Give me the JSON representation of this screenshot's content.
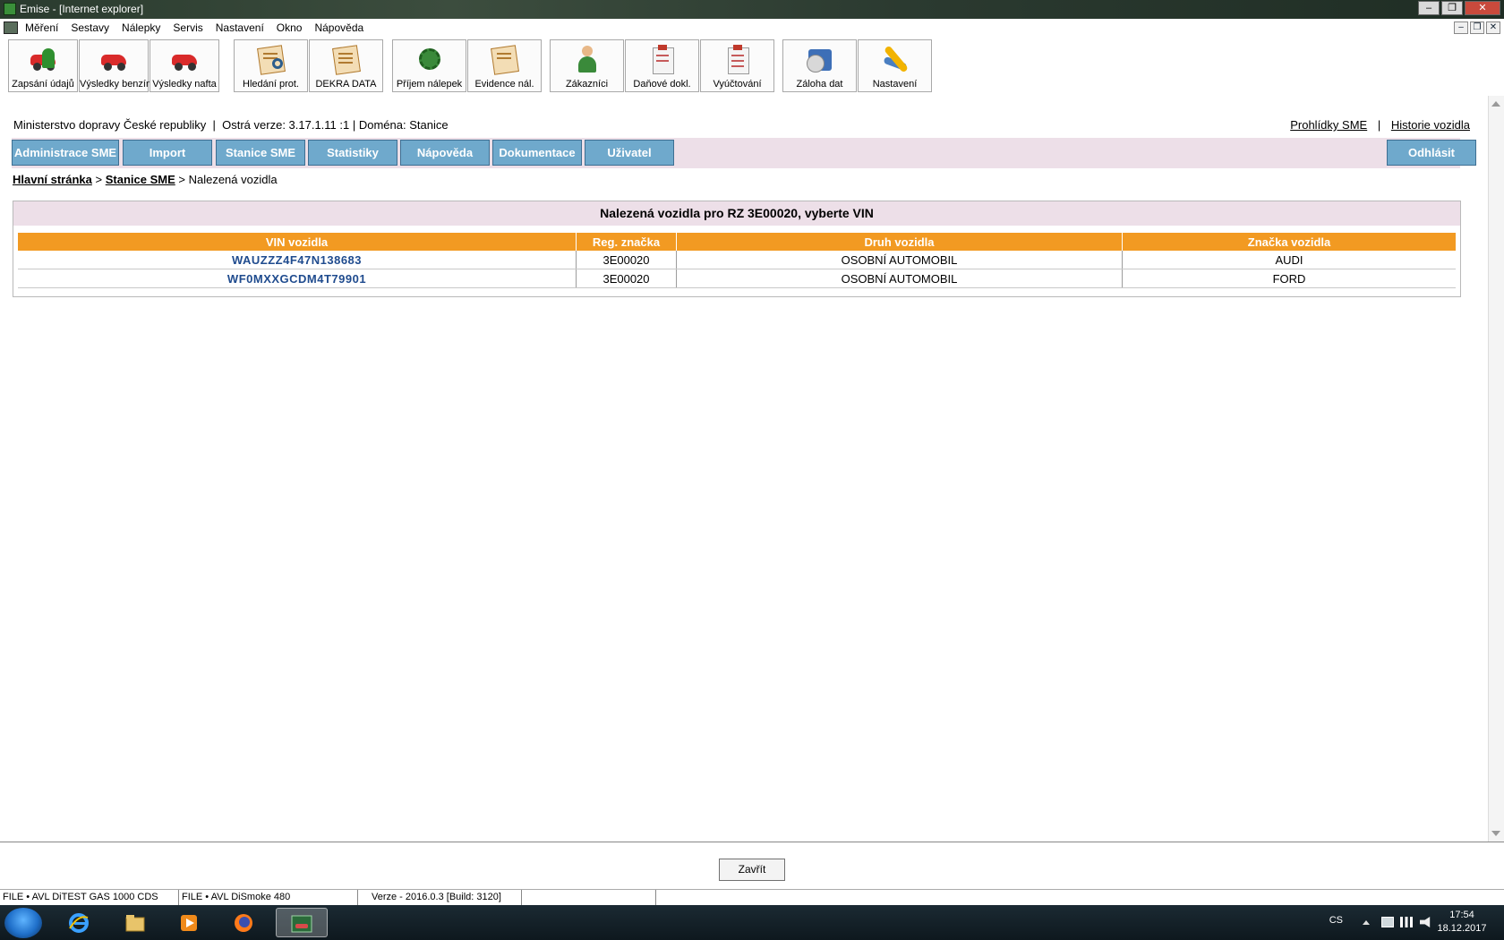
{
  "window": {
    "title": "Emise - [Internet explorer]",
    "buttons": [
      "‒",
      "❐",
      "✕"
    ]
  },
  "menubar": {
    "items": [
      "Měření",
      "Sestavy",
      "Nálepky",
      "Servis",
      "Nastavení",
      "Okno",
      "Nápověda"
    ],
    "mdi_buttons": [
      "‒",
      "❐",
      "✕"
    ]
  },
  "toolbar": {
    "buttons": [
      {
        "label": "Zapsání údajů",
        "icon": "car-person-icon"
      },
      {
        "label": "Výsledky benzín",
        "icon": "red-car-icon"
      },
      {
        "label": "Výsledky nafta",
        "icon": "red-car-icon"
      },
      {
        "label": "Hledání prot.",
        "icon": "document-search-icon"
      },
      {
        "label": "DEKRA DATA",
        "icon": "document-car-icon"
      },
      {
        "label": "Příjem nálepek",
        "icon": "gear-sticker-icon"
      },
      {
        "label": "Evidence nál.",
        "icon": "document-gear-icon"
      },
      {
        "label": "Zákazníci",
        "icon": "customer-icon"
      },
      {
        "label": "Daňové dokl.",
        "icon": "tax-document-icon"
      },
      {
        "label": "Vyúčtování",
        "icon": "billing-clipboard-icon"
      },
      {
        "label": "Záloha dat",
        "icon": "backup-disk-icon"
      },
      {
        "label": "Nastavení",
        "icon": "settings-wrench-icon"
      }
    ]
  },
  "header": {
    "info_text": "Ministerstvo dopravy České republiky  |  Ostrá verze: 3.17.1.11 :1 | Doména: Stanice",
    "link_inspections": "Prohlídky SME",
    "separator": "|",
    "link_history": "Historie vozidla"
  },
  "nav": {
    "items": [
      "Administrace SME",
      "Import",
      "Stanice SME",
      "Statistiky",
      "Nápověda",
      "Dokumentace",
      "Uživatel"
    ],
    "logout": "Odhlásit"
  },
  "breadcrumb": {
    "home": "Hlavní stránka",
    "sep1": ">",
    "stations": "Stanice SME",
    "sep2": ">",
    "current": "Nalezená vozidla"
  },
  "results": {
    "heading": "Nalezená vozidla pro RZ 3E00020, vyberte VIN",
    "columns": [
      "VIN vozidla",
      "Reg. značka",
      "Druh vozidla",
      "Značka vozidla"
    ],
    "rows": [
      [
        "WAUZZZ4F47N138683",
        "3E00020",
        "OSOBNÍ AUTOMOBIL",
        "AUDI"
      ],
      [
        "WF0MXXGCDM4T79901",
        "3E00020",
        "OSOBNÍ AUTOMOBIL",
        "FORD"
      ]
    ]
  },
  "footer": {
    "close_button": "Zavřít"
  },
  "statusbar": {
    "cells": [
      "FILE • AVL DiTEST GAS 1000 CDS",
      "FILE • AVL DiSmoke 480",
      "Verze - 2016.0.3 [Build: 3120]",
      ""
    ]
  },
  "taskbar": {
    "language": "CS",
    "time": "17:54",
    "date": "18.12.2017"
  },
  "colors": {
    "nav_button": "#6fa9cc",
    "nav_background": "#eddfe8",
    "table_header": "#f29a22",
    "vin_link": "#1f4b8e"
  }
}
